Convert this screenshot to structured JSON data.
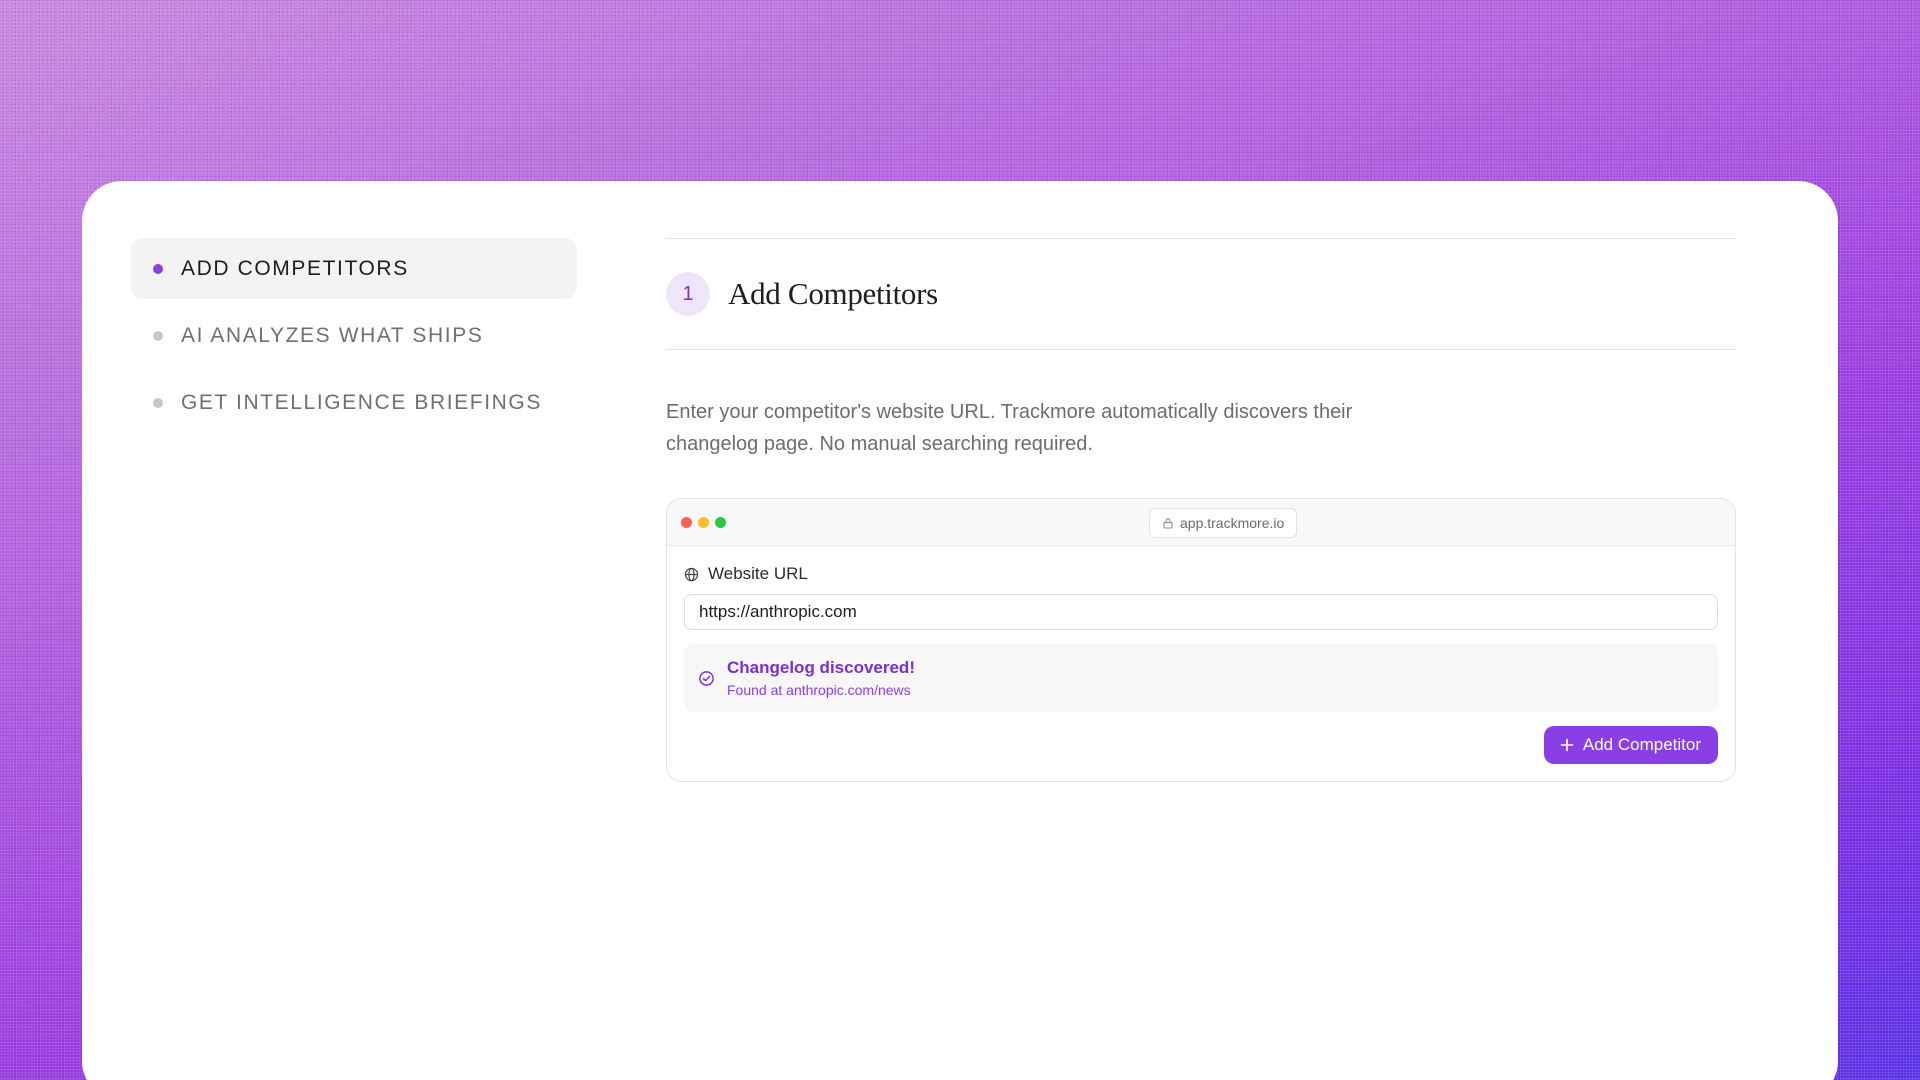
{
  "colors": {
    "accent": "#8a3fe6",
    "accent_text": "#7a2ed6",
    "traffic_red": "#ff5f57",
    "traffic_yellow": "#febc2e",
    "traffic_green": "#28c840"
  },
  "steps": {
    "items": [
      {
        "label": "ADD COMPETITORS",
        "active": true
      },
      {
        "label": "AI ANALYZES WHAT SHIPS",
        "active": false
      },
      {
        "label": "GET INTELLIGENCE BRIEFINGS",
        "active": false
      }
    ]
  },
  "main": {
    "step_number": "1",
    "title": "Add Competitors",
    "description": "Enter your competitor's website URL. Trackmore automatically discovers their changelog page. No manual searching required."
  },
  "browser": {
    "address": "app.trackmore.io",
    "field_label": "Website URL",
    "field_value": "https://anthropic.com",
    "discovered_title": "Changelog discovered!",
    "discovered_subtitle": "Found at anthropic.com/news",
    "add_button_label": "Add Competitor"
  },
  "icons": {
    "address": "lock-icon",
    "field": "globe-icon",
    "status": "check-circle-icon",
    "button": "plus-icon"
  }
}
